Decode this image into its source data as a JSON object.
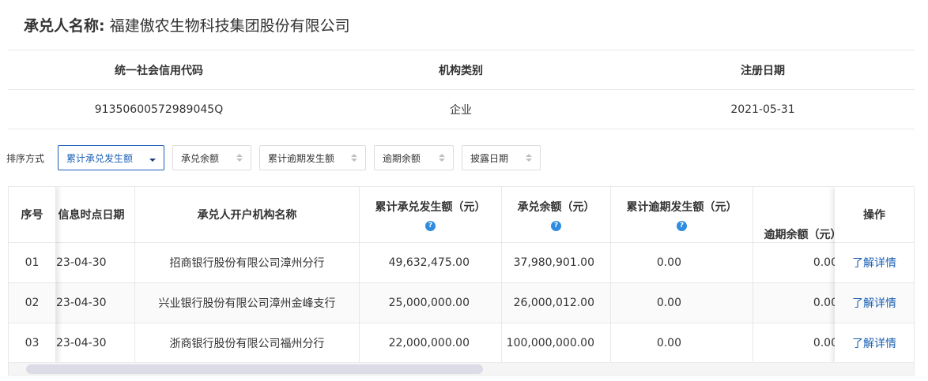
{
  "header": {
    "label": "承兑人名称:",
    "company": "福建傲农生物科技集团股份有限公司"
  },
  "info": {
    "headers": [
      "统一社会信用代码",
      "机构类别",
      "注册日期"
    ],
    "values": [
      "91350600572989045Q",
      "企业",
      "2021-05-31"
    ]
  },
  "sort": {
    "label": "排序方式",
    "options": [
      "累计承兑发生额",
      "承兑余额",
      "累计逾期发生额",
      "逾期余额",
      "披露日期"
    ],
    "active": "累计承兑发生额"
  },
  "table": {
    "headers": {
      "seq": "序号",
      "date": "信息时点日期",
      "org": "承兑人开户机构名称",
      "acc": "累计承兑发生额（元）",
      "bal": "承兑余额（元）",
      "ovacc": "累计逾期发生额（元）",
      "ovbal": "逾期余额（元）",
      "action": "操作"
    },
    "help_glyph": "?",
    "rows": [
      {
        "seq": "01",
        "date": "23-04-30",
        "org": "招商银行股份有限公司漳州分行",
        "acc": "49,632,475.00",
        "bal": "37,980,901.00",
        "ovacc": "0.00",
        "ovbal": "0.00",
        "action": "了解详情"
      },
      {
        "seq": "02",
        "date": "23-04-30",
        "org": "兴业银行股份有限公司漳州金峰支行",
        "acc": "25,000,000.00",
        "bal": "26,000,012.00",
        "ovacc": "0.00",
        "ovbal": "0.00",
        "action": "了解详情"
      },
      {
        "seq": "03",
        "date": "23-04-30",
        "org": "浙商银行股份有限公司福州分行",
        "acc": "22,000,000.00",
        "bal": "100,000,000.00",
        "ovacc": "0.00",
        "ovbal": "0.00",
        "action": "了解详情"
      }
    ]
  },
  "colors": {
    "link": "#1a5fb4",
    "help_icon": "#2f8cde",
    "border": "#e8e8e8"
  }
}
